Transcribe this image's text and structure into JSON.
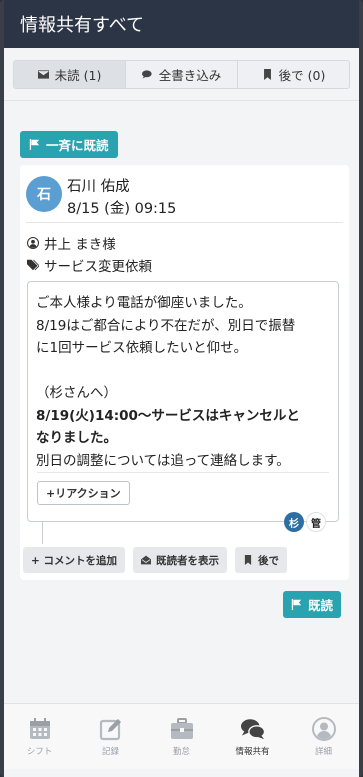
{
  "header": {
    "title": "情報共有すべて"
  },
  "tabs": [
    {
      "label": "未読 (1)",
      "icon": "envelope-icon",
      "active": true
    },
    {
      "label": "全書き込み",
      "icon": "comments-icon",
      "active": false
    },
    {
      "label": "後で (0)",
      "icon": "bookmark-icon",
      "active": false
    }
  ],
  "bulk_read": {
    "label": "一斉に既読",
    "icon": "flag-icon"
  },
  "post": {
    "avatar_initial": "石",
    "author": "石川 佑成",
    "datetime": "8/15 (金) 09:15",
    "customer": "井上 まき様",
    "tag": "サービス変更依頼",
    "message_lines": [
      {
        "text": "ご本人様より電話が御座いました。",
        "bold": false
      },
      {
        "text": "8/19はご都合により不在だが、別日で振替",
        "bold": false
      },
      {
        "text": "に1回サービス依頼したいと仰せ。",
        "bold": false
      },
      {
        "text": "",
        "bold": false
      },
      {
        "text": "（杉さんへ）",
        "bold": false
      },
      {
        "text": "8/19(火)14:00〜サービスはキャンセルと",
        "bold": true
      },
      {
        "text": "なりました。",
        "bold": true
      },
      {
        "text": "別日の調整については追って連絡します。",
        "bold": false
      }
    ],
    "reaction_label": "+リアクション",
    "readers": [
      "杉",
      "管"
    ]
  },
  "actions": {
    "add_comment": "+ コメントを追加",
    "show_readers": "既読者を表示",
    "later": "後で"
  },
  "read_button": {
    "label": "既読"
  },
  "bottom_nav": [
    {
      "label": "シフト",
      "icon": "calendar-icon",
      "active": false
    },
    {
      "label": "記録",
      "icon": "edit-icon",
      "active": false
    },
    {
      "label": "勤怠",
      "icon": "briefcase-icon",
      "active": false
    },
    {
      "label": "情報共有",
      "icon": "comments-icon",
      "active": true
    },
    {
      "label": "詳細",
      "icon": "user-icon",
      "active": false
    }
  ]
}
